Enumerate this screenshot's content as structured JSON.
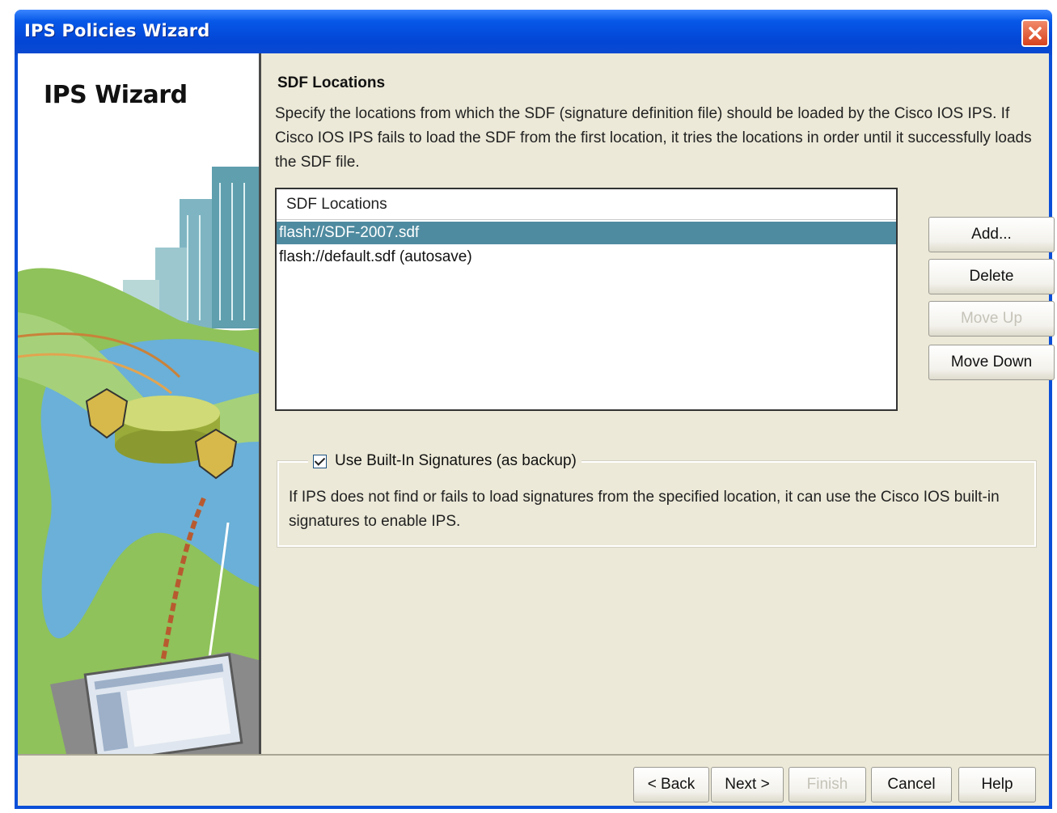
{
  "window": {
    "title": "IPS Policies Wizard"
  },
  "sidebar": {
    "title": "IPS Wizard"
  },
  "page": {
    "section_title": "SDF Locations",
    "description": "Specify the locations from which the SDF (signature definition file) should be loaded by the Cisco IOS IPS. If Cisco IOS IPS fails to load the SDF from the first location, it tries the locations in order until it successfully loads the SDF file."
  },
  "locations": {
    "header": "SDF Locations",
    "rows": [
      {
        "text": "flash://SDF-2007.sdf",
        "selected": true
      },
      {
        "text": "flash://default.sdf  (autosave)",
        "selected": false
      }
    ]
  },
  "side_buttons": {
    "add": "Add...",
    "delete": "Delete",
    "move_up": "Move Up",
    "move_down": "Move Down"
  },
  "builtin": {
    "checkbox_label": "Use Built-In Signatures (as backup)",
    "checked": true,
    "text": "If IPS does not find or fails to load signatures from the specified location, it can use the Cisco IOS built-in signatures to enable IPS."
  },
  "footer": {
    "back": "< Back",
    "next": "Next >",
    "finish": "Finish",
    "cancel": "Cancel",
    "help": "Help"
  },
  "colors": {
    "titlebar": "#0346d5",
    "selection": "#4f8ba0",
    "dialog_bg": "#ece9d8",
    "close_button": "#d8421e"
  }
}
